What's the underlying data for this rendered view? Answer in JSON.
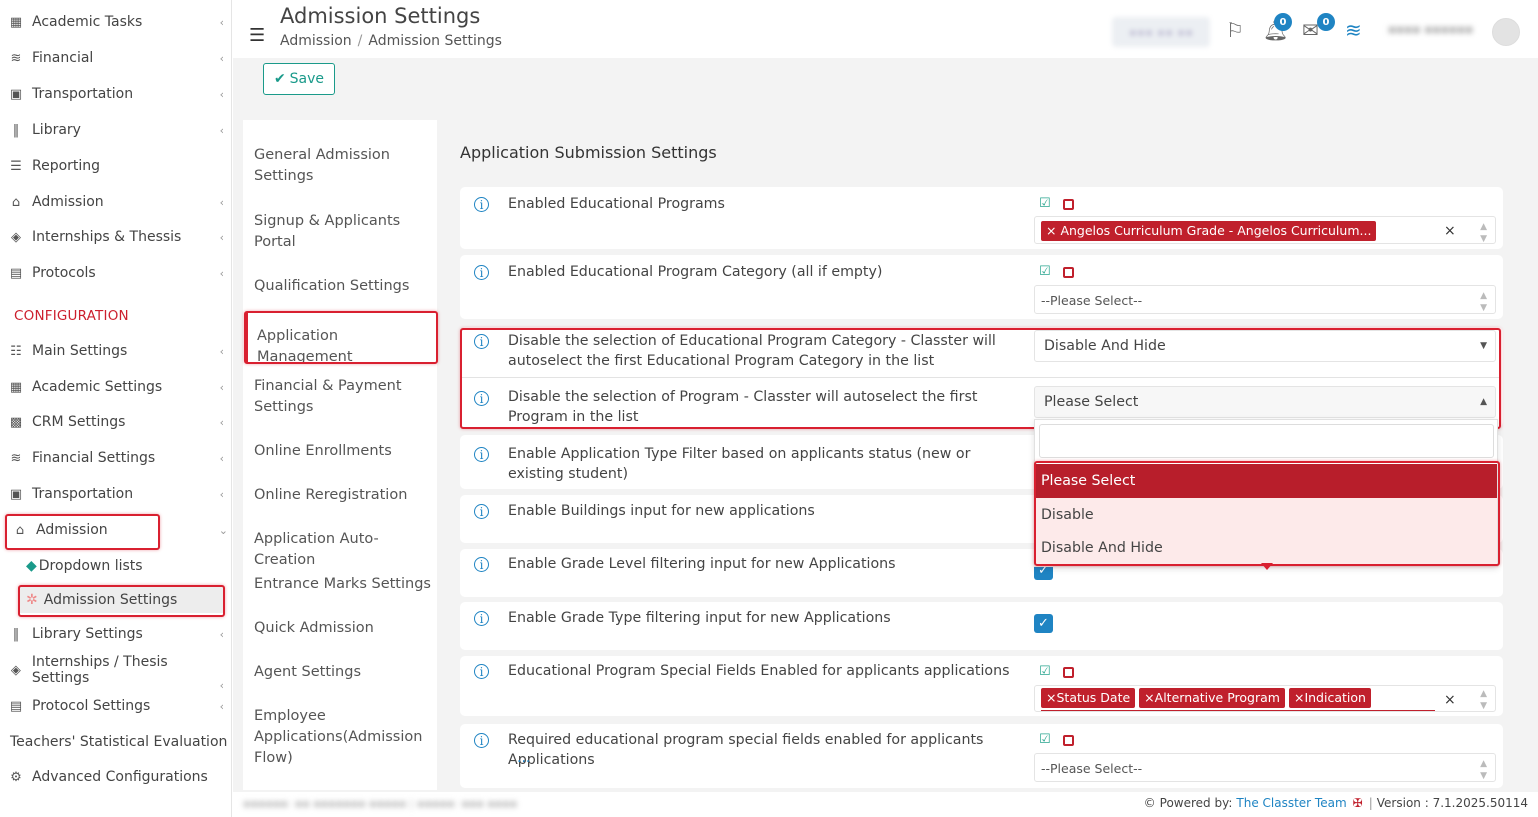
{
  "sidebar": {
    "items": [
      {
        "label": "Academic Tasks",
        "icon": "grid-icon"
      },
      {
        "label": "Financial",
        "icon": "coins-icon"
      },
      {
        "label": "Transportation",
        "icon": "bus-icon"
      },
      {
        "label": "Library",
        "icon": "books-icon"
      },
      {
        "label": "Reporting",
        "icon": "report-icon"
      },
      {
        "label": "Admission",
        "icon": "institution-icon"
      },
      {
        "label": "Internships & Thessis",
        "icon": "box-icon"
      },
      {
        "label": "Protocols",
        "icon": "archive-icon"
      }
    ],
    "config_heading": "CONFIGURATION",
    "config_items": [
      {
        "label": "Main Settings",
        "icon": "sliders-icon"
      },
      {
        "label": "Academic Settings",
        "icon": "grid-icon"
      },
      {
        "label": "CRM Settings",
        "icon": "crm-icon"
      },
      {
        "label": "Financial Settings",
        "icon": "coins-icon"
      },
      {
        "label": "Transportation",
        "icon": "bus-icon"
      },
      {
        "label": "Admission",
        "icon": "institution-icon"
      }
    ],
    "admission_sub": [
      {
        "label": "Dropdown lists",
        "icon": "layers-icon"
      },
      {
        "label": "Admission Settings",
        "icon": "gear-icon"
      }
    ],
    "bottom_items": [
      {
        "label": "Library Settings",
        "icon": "books-icon"
      },
      {
        "label": "Internships / Thesis Settings",
        "icon": "box-icon"
      },
      {
        "label": "Protocol Settings",
        "icon": "archive-icon"
      },
      {
        "label": "Teachers' Statistical Evaluation",
        "icon": ""
      },
      {
        "label": "Advanced Configurations",
        "icon": "gears-icon"
      }
    ]
  },
  "header": {
    "title": "Admission Settings",
    "breadcrumb": [
      "Admission",
      "Admission Settings"
    ],
    "notifications_count": "0",
    "messages_count": "0"
  },
  "toolbar": {
    "save_label": "Save"
  },
  "subnav": [
    "General Admission Settings",
    "Signup & Applicants Portal",
    "Qualification Settings",
    "Application Management",
    "Financial & Payment Settings",
    "Online Enrollments",
    "Online Reregistration",
    "Application Auto-Creation",
    "Entrance Marks Settings",
    "Quick Admission",
    "Agent Settings",
    "Employee Applications(Admission Flow)"
  ],
  "section": {
    "title": "Application Submission Settings",
    "rows": [
      {
        "label": "Enabled Educational Programs",
        "tags": [
          "Angelos Curriculum Grade - Angelos Curriculum..."
        ]
      },
      {
        "label": "Enabled Educational Program Category (all if empty)",
        "placeholder": "--Please Select--"
      },
      {
        "label": "Disable the selection of Educational Program Category - Classter will autoselect the first Educational Program Category in the list",
        "value": "Disable And Hide"
      },
      {
        "label": "Disable the selection of Program - Classter will autoselect the first Program in the list",
        "value": "Please Select"
      },
      {
        "label": "Enable Application Type Filter based on applicants status (new or existing student)"
      },
      {
        "label": "Enable Buildings input for new applications"
      },
      {
        "label": "Enable Grade Level filtering input for new Applications"
      },
      {
        "label": "Enable Grade Type filtering input for new Applications"
      },
      {
        "label": "Educational Program Special Fields Enabled for applicants applications",
        "tags": [
          "Status Date",
          "Alternative Program",
          "Indication"
        ]
      },
      {
        "label": "Required educational program special fields enabled for applicants Applications",
        "placeholder": "--Please Select--",
        "more": "..."
      }
    ]
  },
  "dropdown": {
    "options": [
      "Please Select",
      "Disable",
      "Disable And Hide"
    ]
  },
  "footer": {
    "powered_by": "Powered by:",
    "team": "The Classter Team",
    "version": "Version : 7.1.2025.50114"
  },
  "colors": {
    "accent": "#1f84c3",
    "brand_red": "#c0202c",
    "teal": "#1a9a8a"
  }
}
